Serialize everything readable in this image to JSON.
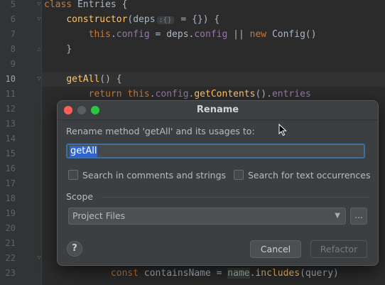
{
  "editor": {
    "lines": [
      {
        "num": "5"
      },
      {
        "num": "6"
      },
      {
        "num": "7"
      },
      {
        "num": "8"
      },
      {
        "num": "9"
      },
      {
        "num": "10"
      },
      {
        "num": "11"
      },
      {
        "num": "12"
      },
      {
        "num": "13"
      },
      {
        "num": "14"
      },
      {
        "num": "15"
      },
      {
        "num": "16"
      },
      {
        "num": "17"
      },
      {
        "num": "18"
      },
      {
        "num": "19"
      },
      {
        "num": "20"
      },
      {
        "num": "21"
      },
      {
        "num": "22"
      },
      {
        "num": "23"
      }
    ],
    "code": {
      "l5_kw": "class",
      "l5_rest": " Entries {",
      "l6_fn": "constructor",
      "l6_a": "(deps",
      "l6_hint": ":{}",
      "l6_b": " = {}) {",
      "l7_this": "this",
      "l7_dot": ".",
      "l7_config": "config",
      "l7_mid": " = deps.",
      "l7_config2": "config",
      "l7_or": " || ",
      "l7_new": "new",
      "l7_end": " Config()",
      "l8": "}",
      "l10_fn": "getAll",
      "l10_rest": "() {",
      "l11_ret": "return",
      "l11_sp": " ",
      "l11_this": "this",
      "l11_dot": ".",
      "l11_config": "config",
      "l11_dot2": ".",
      "l11_fn": "getContents",
      "l11_mid": "().",
      "l11_entries": "entries",
      "l23_const": "const",
      "l23_a": " containsName = ",
      "l23_name": "name",
      "l23_dot": ".",
      "l23_fn": "includes",
      "l23_end": "(query)"
    }
  },
  "dialog": {
    "title": "Rename",
    "prompt": "Rename method 'getAll' and its usages to:",
    "new_name_value": "getAll",
    "checkbox_comments": "Search in comments and strings",
    "checkbox_text": "Search for text occurrences",
    "scope_label": "Scope",
    "scope_value": "Project Files",
    "more_button": "...",
    "help_button": "?",
    "cancel_button": "Cancel",
    "refactor_button": "Refactor"
  },
  "colors": {
    "editor_bg": "#2b2b2b",
    "keyword": "#cc7832",
    "function": "#ffc66d",
    "property": "#9876aa",
    "selection": "#2f65ca",
    "focus_border": "#3e6f9e"
  },
  "icons": {
    "close": "red-dot",
    "minimize": "yellow-dot",
    "zoom": "green-dot",
    "dropdown": "chevron-down-icon"
  }
}
